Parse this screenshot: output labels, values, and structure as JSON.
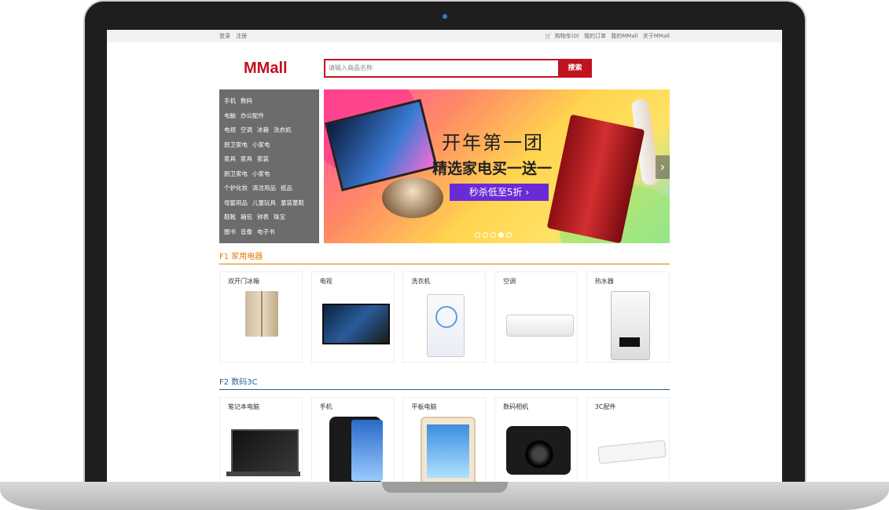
{
  "topbar": {
    "login": "登录",
    "register": "注册",
    "cart": "购物车(0)",
    "orders": "我的订单",
    "my_mall": "我的MMall",
    "about": "关于MMall"
  },
  "logo": "MMall",
  "search": {
    "placeholder": "请输入商品名称",
    "button": "搜索"
  },
  "categories": [
    [
      "手机",
      "数码"
    ],
    [
      "电脑",
      "办公配件"
    ],
    [
      "电视",
      "空调",
      "冰箱",
      "洗衣机"
    ],
    [
      "厨卫家电",
      "小家电"
    ],
    [
      "家具",
      "家具",
      "家装"
    ],
    [
      "厨卫家电",
      "小家电"
    ],
    [
      "个护化妆",
      "清洁用品",
      "纸品"
    ],
    [
      "母婴用品",
      "儿童玩具",
      "童装童鞋"
    ],
    [
      "鞋靴",
      "箱包",
      "钟表",
      "珠宝"
    ],
    [
      "图书",
      "音像",
      "电子书"
    ]
  ],
  "banner": {
    "headline": "开年第一团",
    "subline": "精选家电买一送一",
    "promo": "秒杀低至5折 ›",
    "slide_count": 5,
    "active_slide": 4
  },
  "floors": [
    {
      "title": "F1 家用电器",
      "color": "#e07b00",
      "items": [
        "双开门冰箱",
        "电视",
        "洗衣机",
        "空调",
        "热水器"
      ],
      "icons": [
        "fridge-icon",
        "tv-icon",
        "washer-icon",
        "air-conditioner-icon",
        "water-heater-icon"
      ]
    },
    {
      "title": "F2 数码3C",
      "color": "#2b5f8a",
      "items": [
        "笔记本电脑",
        "手机",
        "平板电脑",
        "数码相机",
        "3C配件"
      ],
      "icons": [
        "laptop-icon",
        "phone-icon",
        "tablet-icon",
        "camera-icon",
        "power-strip-icon"
      ]
    }
  ]
}
